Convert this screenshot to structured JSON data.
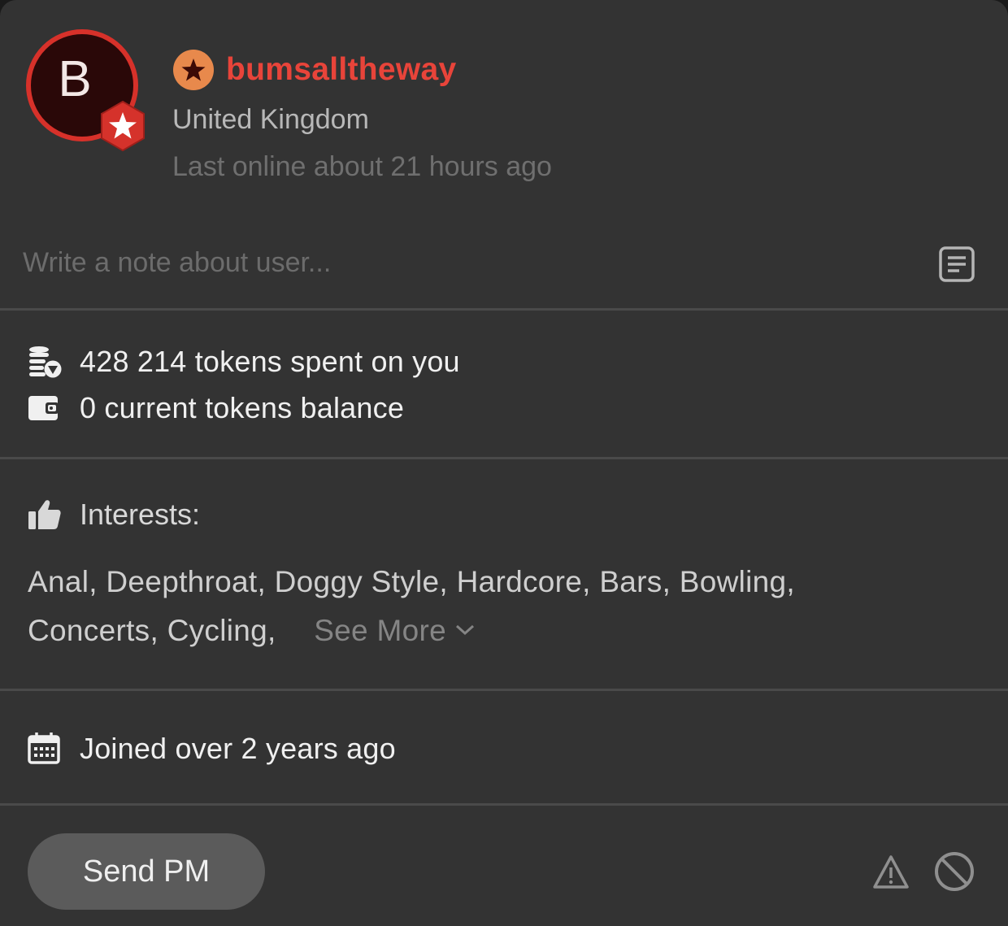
{
  "user": {
    "avatar_letter": "B",
    "username": "bumsalltheway",
    "country": "United Kingdom",
    "last_online": "Last online about 21 hours ago"
  },
  "note": {
    "placeholder": "Write a note about user..."
  },
  "stats": {
    "tokens_spent": "428 214 tokens spent on you",
    "tokens_balance": "0 current tokens balance"
  },
  "interests": {
    "label": "Interests:",
    "list": "Anal, Deepthroat, Doggy Style, Hardcore, Bars, Bowling, Concerts, Cycling,",
    "see_more": "See More"
  },
  "joined": "Joined over 2 years ago",
  "actions": {
    "send_pm": "Send PM"
  },
  "colors": {
    "accent": "#e8443a",
    "background": "#333333",
    "button": "#5b5b5b"
  },
  "icons": [
    "star-badge-icon",
    "rank-star-icon",
    "note-icon",
    "coins-icon",
    "wallet-icon",
    "thumbs-up-icon",
    "chevron-down-icon",
    "calendar-icon",
    "report-icon",
    "block-icon"
  ]
}
